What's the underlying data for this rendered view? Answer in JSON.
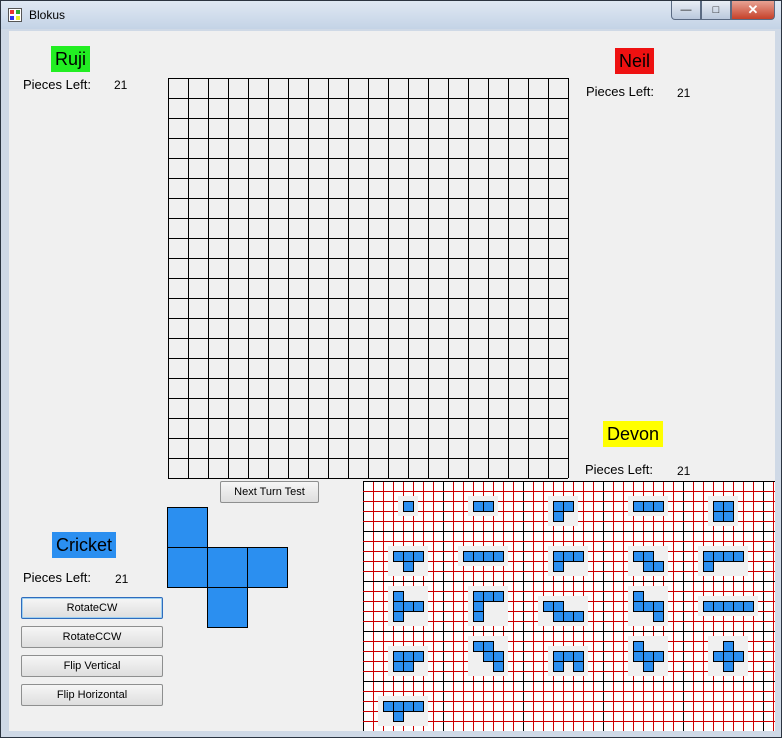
{
  "window": {
    "title": "Blokus"
  },
  "caption_buttons": {
    "minimize": "—",
    "maximize": "□",
    "close": "✕"
  },
  "players": {
    "top_left": {
      "name": "Ruji",
      "color": "#22ee22",
      "pieces_label": "Pieces Left:",
      "pieces": "21"
    },
    "top_right": {
      "name": "Neil",
      "color": "#ee1111",
      "pieces_label": "Pieces Left:",
      "pieces": "21"
    },
    "bottom_right": {
      "name": "Devon",
      "color": "#ffff00",
      "pieces_label": "Pieces Left:",
      "pieces": "21"
    },
    "bottom_left": {
      "name": "Cricket",
      "color": "#2b8ff0",
      "pieces_label": "Pieces Left:",
      "pieces": "21"
    }
  },
  "board": {
    "columns": 20,
    "rows": 20
  },
  "buttons": {
    "next_turn": "Next Turn Test",
    "rotate_cw": "RotateCW",
    "rotate_ccw": "RotateCCW",
    "flip_vertical": "Flip Vertical",
    "flip_horizontal": "Flip Horizontal"
  },
  "current_piece": {
    "color": "#2b8ff0",
    "cells": [
      [
        0,
        0
      ],
      [
        0,
        1
      ],
      [
        1,
        1
      ],
      [
        2,
        1
      ],
      [
        1,
        2
      ]
    ]
  },
  "tray": {
    "grid_color": "#cc0000",
    "piece_color": "#2b8ff0",
    "pieces": [
      [
        [
          0,
          0
        ]
      ],
      [
        [
          0,
          0
        ],
        [
          1,
          0
        ]
      ],
      [
        [
          0,
          0
        ],
        [
          1,
          0
        ],
        [
          0,
          1
        ]
      ],
      [
        [
          0,
          0
        ],
        [
          1,
          0
        ],
        [
          2,
          0
        ]
      ],
      [
        [
          0,
          0
        ],
        [
          1,
          0
        ],
        [
          0,
          1
        ],
        [
          1,
          1
        ]
      ],
      [
        [
          0,
          0
        ],
        [
          1,
          0
        ],
        [
          2,
          0
        ],
        [
          1,
          1
        ]
      ],
      [
        [
          0,
          0
        ],
        [
          1,
          0
        ],
        [
          2,
          0
        ],
        [
          3,
          0
        ]
      ],
      [
        [
          0,
          0
        ],
        [
          1,
          0
        ],
        [
          2,
          0
        ],
        [
          0,
          1
        ]
      ],
      [
        [
          0,
          0
        ],
        [
          1,
          0
        ],
        [
          1,
          1
        ],
        [
          2,
          1
        ]
      ],
      [
        [
          0,
          0
        ],
        [
          1,
          0
        ],
        [
          2,
          0
        ],
        [
          3,
          0
        ],
        [
          0,
          1
        ]
      ],
      [
        [
          0,
          0
        ],
        [
          0,
          1
        ],
        [
          1,
          1
        ],
        [
          2,
          1
        ],
        [
          0,
          2
        ]
      ],
      [
        [
          0,
          0
        ],
        [
          1,
          0
        ],
        [
          2,
          0
        ],
        [
          0,
          1
        ],
        [
          0,
          2
        ]
      ],
      [
        [
          0,
          0
        ],
        [
          1,
          0
        ],
        [
          1,
          1
        ],
        [
          2,
          1
        ],
        [
          3,
          1
        ]
      ],
      [
        [
          0,
          0
        ],
        [
          0,
          1
        ],
        [
          1,
          1
        ],
        [
          2,
          1
        ],
        [
          2,
          2
        ]
      ],
      [
        [
          0,
          0
        ],
        [
          1,
          0
        ],
        [
          2,
          0
        ],
        [
          3,
          0
        ],
        [
          4,
          0
        ]
      ],
      [
        [
          0,
          0
        ],
        [
          1,
          0
        ],
        [
          2,
          0
        ],
        [
          0,
          1
        ],
        [
          1,
          1
        ]
      ],
      [
        [
          0,
          0
        ],
        [
          1,
          0
        ],
        [
          1,
          1
        ],
        [
          2,
          1
        ],
        [
          2,
          2
        ]
      ],
      [
        [
          0,
          0
        ],
        [
          1,
          0
        ],
        [
          2,
          0
        ],
        [
          0,
          1
        ],
        [
          2,
          1
        ]
      ],
      [
        [
          0,
          0
        ],
        [
          0,
          1
        ],
        [
          1,
          1
        ],
        [
          2,
          1
        ],
        [
          1,
          2
        ]
      ],
      [
        [
          1,
          0
        ],
        [
          0,
          1
        ],
        [
          1,
          1
        ],
        [
          2,
          1
        ],
        [
          1,
          2
        ]
      ],
      [
        [
          0,
          0
        ],
        [
          1,
          0
        ],
        [
          2,
          0
        ],
        [
          3,
          0
        ],
        [
          1,
          1
        ]
      ]
    ]
  }
}
